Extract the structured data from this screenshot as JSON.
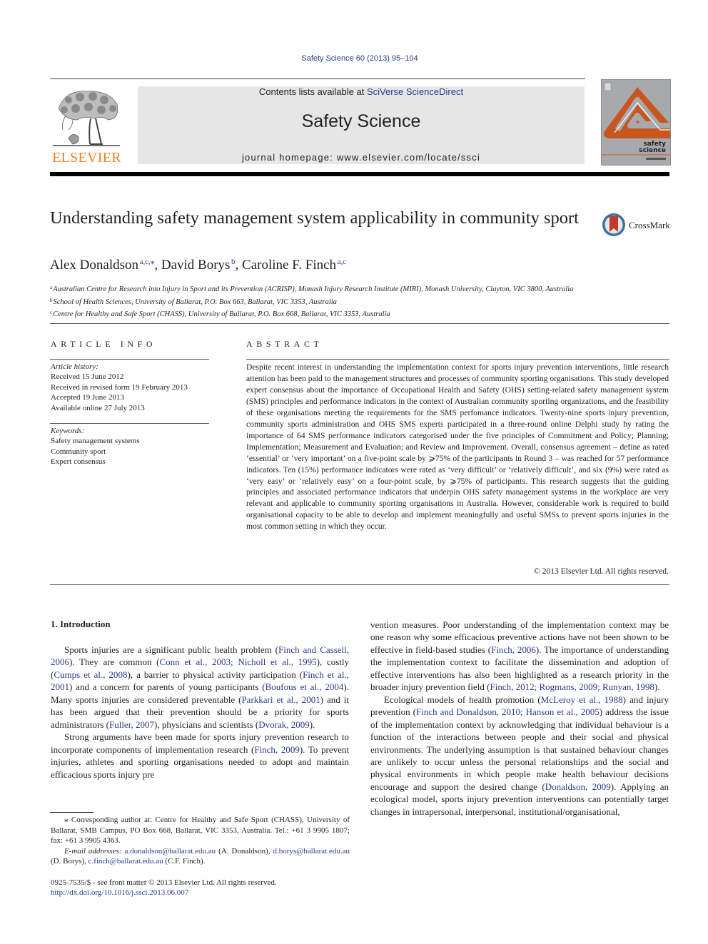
{
  "header": {
    "citation": "Safety Science 60 (2013) 95–104",
    "contents_prefix": "Contents lists available at ",
    "contents_link": "SciVerse ScienceDirect",
    "journal_title": "Safety Science",
    "homepage": "journal homepage: www.elsevier.com/locate/ssci",
    "publisher_logo_text": "ELSEVIER",
    "cover_title_line1": "safety",
    "cover_title_line2": "science",
    "colors": {
      "link": "#2b3990",
      "elsevier_orange": "#f58220",
      "cover_orange": "#c8561e",
      "masthead_bg": "#e6e6e6"
    }
  },
  "article": {
    "title": "Understanding safety management system applicability in community sport",
    "crossmark_label": "CrossMark",
    "authors": [
      {
        "name": "Alex Donaldson",
        "sup": "a,c,⁎"
      },
      {
        "name": "David Borys",
        "sup": "b"
      },
      {
        "name": "Caroline F. Finch",
        "sup": "a,c"
      }
    ],
    "affiliations": [
      {
        "mark": "a",
        "text": "Australian Centre for Research into Injury in Sport and its Prevention (ACRISP), Monash Injury Research Institute (MIRI), Monash University, Clayton, VIC 3800, Australia"
      },
      {
        "mark": "b",
        "text": "School of Health Sciences, University of Ballarat, P.O. Box 663, Ballarat, VIC 3353, Australia"
      },
      {
        "mark": "c",
        "text": "Centre for Healthy and Safe Sport (CHASS), University of Ballarat, P.O. Box 668, Ballarat, VIC 3353, Australia"
      }
    ]
  },
  "article_info": {
    "heading": "ARTICLE INFO",
    "history_label": "Article history:",
    "history": [
      "Received 15 June 2012",
      "Received in revised form 19 February 2013",
      "Accepted 19 June 2013",
      "Available online 27 July 2013"
    ],
    "keywords_label": "Keywords:",
    "keywords": [
      "Safety management systems",
      "Community sport",
      "Expert consensus"
    ]
  },
  "abstract": {
    "heading": "ABSTRACT",
    "text": "Despite recent interest in understanding the implementation context for sports injury prevention interventions, little research attention has been paid to the management structures and processes of community sporting organisations. This study developed expert consensus about the importance of Occupational Health and Safety (OHS) setting-related safety management system (SMS) principles and performance indicators in the context of Australian community sporting organizations, and the feasibility of these organisations meeting the requirements for the SMS perfomance indicators. Twenty-nine sports injury prevention, community sports administration and OHS SMS experts participated in a three-round online Delphi study by rating the importance of 64 SMS performance indicators categorised under the five principles of Commitment and Policy; Planning; Implementation; Measurement and Evaluation; and Review and Improvement. Overall, consensus agreement – define as rated ‘essential’ or ‘very important’ on a five-point scale by ⩾75% of the participants in Round 3 – was reached for 57 performance indicators. Ten (15%) performance indicators were rated as ‘very difficult’ or ‘relatively difficult’, and six (9%) were rated as ‘very easy’ or ‘relatively easy’ on a four-point scale, by ⩾75% of participants. This research suggests that the guiding principles and associated performance indicators that underpin OHS safety management systems in the workplace are very relevant and applicable to community sporting organisations in Australia. However, considerable work is required to build organisational capacity to be able to develop and implement meaningfully and useful SMSs to prevent sports injuries in the most common setting in which they occur.",
    "copyright": "© 2013 Elsevier Ltd. All rights reserved."
  },
  "body": {
    "section_heading": "1. Introduction",
    "left_paragraphs": [
      [
        {
          "t": "Sports injuries are a significant public health problem ("
        },
        {
          "t": "Finch and Cassell, 2006",
          "link": true
        },
        {
          "t": "). They are common ("
        },
        {
          "t": "Conn et al., 2003; Nicholl et al., 1995",
          "link": true
        },
        {
          "t": "), costly ("
        },
        {
          "t": "Cumps et al., 2008",
          "link": true
        },
        {
          "t": "), a barrier to physical activity participation ("
        },
        {
          "t": "Finch et al., 2001",
          "link": true
        },
        {
          "t": ") and a concern for parents of young participants ("
        },
        {
          "t": "Boufous et al., 2004",
          "link": true
        },
        {
          "t": "). Many sports injuries are considered preventable ("
        },
        {
          "t": "Parkkari et al., 2001",
          "link": true
        },
        {
          "t": ") and it has been argued that their prevention should be a priority for sports administrators ("
        },
        {
          "t": "Fuller, 2007",
          "link": true
        },
        {
          "t": "), physicians and scientists ("
        },
        {
          "t": "Dvorak, 2009",
          "link": true
        },
        {
          "t": ")."
        }
      ],
      [
        {
          "t": "Strong arguments have been made for sports injury prevention research to incorporate components of implementation research ("
        },
        {
          "t": "Finch, 2009",
          "link": true
        },
        {
          "t": "). To prevent injuries, athletes and sporting organisations needed to adopt and maintain efficacious sports injury pre­"
        }
      ]
    ],
    "right_paragraphs": [
      [
        {
          "t": "vention measures. Poor understanding of the implementation context may be one reason why some efficacious preventive actions have not been shown to be effective in field-based studies ("
        },
        {
          "t": "Finch, 2006",
          "link": true
        },
        {
          "t": "). The importance of understanding the implementation context to facilitate the dissemination and adoption of effective interventions has also been highlighted as a research priority in the broader injury prevention field ("
        },
        {
          "t": "Finch, 2012; Rogmans, 2009; Runyan, 1998",
          "link": true
        },
        {
          "t": ")."
        }
      ],
      [
        {
          "t": "Ecological models of health promotion ("
        },
        {
          "t": "McLeroy et al., 1988",
          "link": true
        },
        {
          "t": ") and injury prevention ("
        },
        {
          "t": "Finch and Donaldson, 2010; Hanson et al., 2005",
          "link": true
        },
        {
          "t": ") address the issue of the implementation context by acknowledging that individual behaviour is a function of the interactions between people and their social and physical environments. The underlying assumption is that sustained behaviour changes are unlikely to occur unless the personal relationships and the social and physical environments in which people make health behaviour decisions encourage and support the desired change ("
        },
        {
          "t": "Donaldson, 2009",
          "link": true
        },
        {
          "t": "). Applying an ecological model, sports injury prevention interventions can potentially target changes in intrapersonal, interpersonal, institutional/organisational,"
        }
      ]
    ]
  },
  "footnotes": {
    "corresponding": "⁎ Corresponding author at: Centre for Healthy and Safe Sport (CHASS), University of Ballarat, SMB Campus, PO Box 668, Ballarat, VIC 3353, Australia. Tel.: +61 3 9905 1807; fax: +61 3 9905 4363.",
    "email_label": "E-mail addresses:",
    "emails": [
      {
        "address": "a.donaldson@ballarat.edu.au",
        "owner": "(A. Donaldson)"
      },
      {
        "address": "d.borys@ballarat.edu.au",
        "owner": "(D. Borys)"
      },
      {
        "address": "c.finch@ballarat.edu.au",
        "owner": "(C.F. Finch)."
      }
    ],
    "issn_line": "0925-7535/$ - see front matter © 2013 Elsevier Ltd. All rights reserved.",
    "doi": "http://dx.doi.org/10.1016/j.ssci.2013.06.007"
  }
}
